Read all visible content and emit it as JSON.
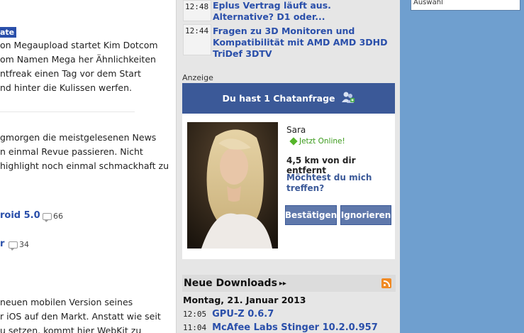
{
  "left": {
    "badge": "ate",
    "para1": [
      "on Megaupload startet Kim Dotcom",
      "om Namen Mega her Ähnlichkeiten",
      "ntfreak einen Tag vor dem Start",
      "nd hinter die Kulissen werfen."
    ],
    "para2": [
      "gmorgen die meistgelesenen News",
      "n einmal Revue passieren. Nicht",
      "highlight noch einmal schmackhaft zu"
    ],
    "link1": "roid 5.0",
    "link1_comments": "66",
    "link2": "r",
    "link2_comments": "34",
    "para3": [
      "neuen mobilen Version seines",
      "r iOS auf den Markt. Anstatt wie seit",
      "u setzen, kommt hier WebKit zu"
    ]
  },
  "news": [
    {
      "time": "12:48",
      "title": "Eplus Vertrag läuft aus. Alternative? D1 oder..."
    },
    {
      "time": "12:44",
      "title": "Fragen zu 3D Monitoren und Kompatibilität mit AMD AMD 3DHD TriDef 3DTV"
    }
  ],
  "ad": {
    "label": "Anzeige",
    "header": "Du hast 1 Chatanfrage",
    "name": "Sara",
    "online": "Jetzt Online!",
    "distance": "4,5 km von dir entfernt",
    "question": "Möchtest du mich treffen?",
    "confirm": "Bestätigen",
    "ignore": "Ignorieren"
  },
  "downloads": {
    "title": "Neue Downloads",
    "arrows": "▸▸",
    "date": "Montag, 21. Januar 2013",
    "items": [
      {
        "time": "12:05",
        "name": "GPU-Z 0.6.7"
      },
      {
        "time": "11:04",
        "name": "McAfee Labs Stinger 10.2.0.957"
      }
    ]
  },
  "right": {
    "box_text": "Auswahl"
  },
  "colors": {
    "link": "#2a4faa",
    "fb_blue": "#3b5998",
    "sidebar_bg": "#6f9fcf",
    "online_green": "#3a9a1a"
  }
}
